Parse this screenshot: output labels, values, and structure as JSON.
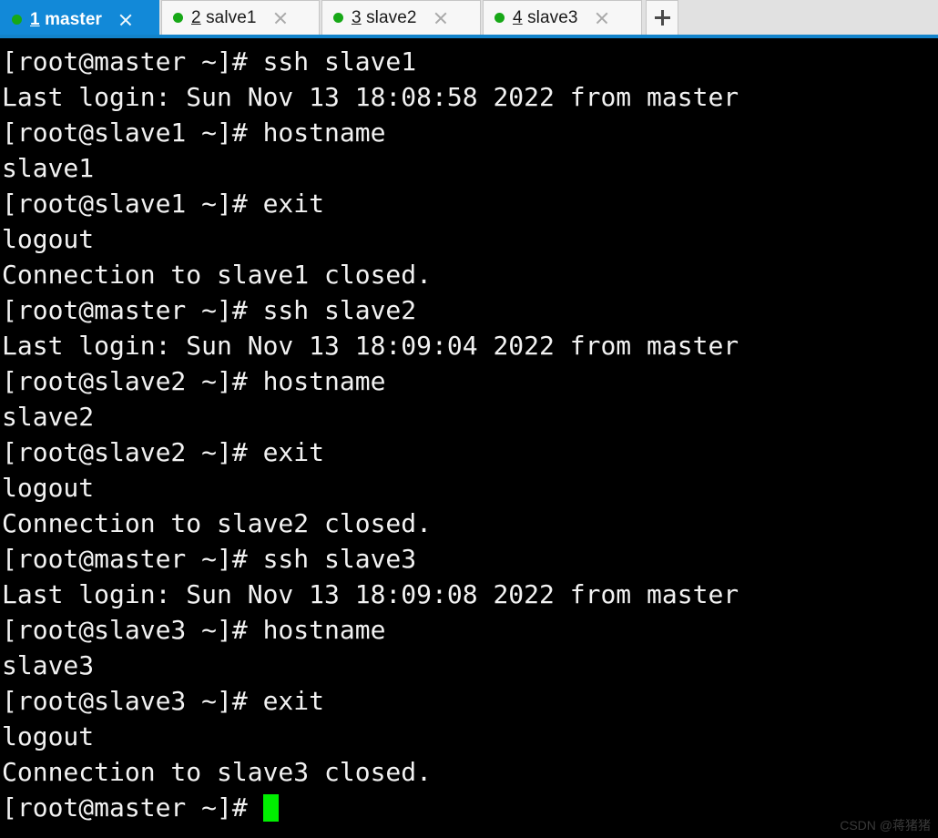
{
  "window": {
    "title": "master",
    "app": "ssh terminal"
  },
  "tabbar": {
    "accent_color": "#1289d8",
    "underline_color": "#1283cb",
    "background_color": "#e1e1e1",
    "indicator_color": "#17a817",
    "new_tab_label": "+",
    "new_tab_icon": "plus-icon",
    "close_icon": "close-icon",
    "status_icon": "status-dot-icon",
    "tabs": [
      {
        "index": "1",
        "name": "master",
        "active": true,
        "close_label": "×",
        "status": "connected"
      },
      {
        "index": "2",
        "name": "salve1",
        "active": false,
        "close_label": "×",
        "status": "connected"
      },
      {
        "index": "3",
        "name": "slave2",
        "active": false,
        "close_label": "×",
        "status": "connected"
      },
      {
        "index": "4",
        "name": "slave3",
        "active": false,
        "close_label": "×",
        "status": "connected"
      }
    ]
  },
  "terminal": {
    "foreground_color": "#f2f2f2",
    "background_color": "#000000",
    "cursor_color": "#00ef00",
    "lines": [
      "[root@master ~]# ssh slave1",
      "Last login: Sun Nov 13 18:08:58 2022 from master",
      "[root@slave1 ~]# hostname",
      "slave1",
      "[root@slave1 ~]# exit",
      "logout",
      "Connection to slave1 closed.",
      "[root@master ~]# ssh slave2",
      "Last login: Sun Nov 13 18:09:04 2022 from master",
      "[root@slave2 ~]# hostname",
      "slave2",
      "[root@slave2 ~]# exit",
      "logout",
      "Connection to slave2 closed.",
      "[root@master ~]# ssh slave3",
      "Last login: Sun Nov 13 18:09:08 2022 from master",
      "[root@slave3 ~]# hostname",
      "slave3",
      "[root@slave3 ~]# exit",
      "logout",
      "Connection to slave3 closed."
    ],
    "prompt": "[root@master ~]# "
  },
  "watermark": {
    "text": "CSDN @蒋猪猪"
  }
}
